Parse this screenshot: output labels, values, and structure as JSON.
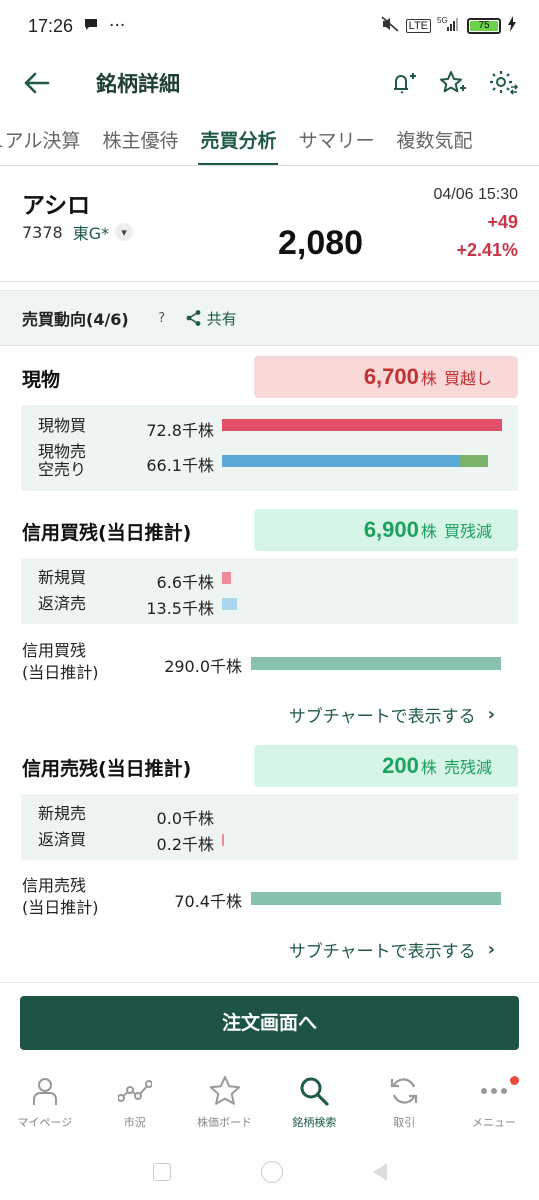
{
  "status_bar": {
    "time": "17:26",
    "battery": "75",
    "network": "5G"
  },
  "app_bar": {
    "title": "銘柄詳細"
  },
  "tabs": [
    {
      "label": "ュアル決算"
    },
    {
      "label": "株主優待"
    },
    {
      "label": "売買分析",
      "active": true
    },
    {
      "label": "サマリー"
    },
    {
      "label": "複数気配"
    }
  ],
  "stock": {
    "name": "アシロ",
    "code": "7378",
    "market": "東G*",
    "price": "2,080",
    "datetime": "04/06 15:30",
    "change": "+49",
    "change_pct": "+2.41%"
  },
  "trend": {
    "title": "売買動向(4/6)",
    "help": "?",
    "share": "共有"
  },
  "genbutsu": {
    "label": "現物",
    "summary_num": "6,700",
    "summary_unit": "株",
    "summary_text": "買越し",
    "rows": [
      {
        "label": "現物買",
        "value": "72.8千株"
      },
      {
        "label": "現物売",
        "label2": "空売り",
        "value": "66.1千株"
      }
    ],
    "buy_fraction": 1.0,
    "sell_fraction": 0.85,
    "short_fraction": 0.1
  },
  "margin_buy": {
    "label": "信用買残(当日推計)",
    "summary_num": "6,900",
    "summary_unit": "株",
    "summary_text": "買残減",
    "rows": [
      {
        "label": "新規買",
        "value": "6.6千株"
      },
      {
        "label": "返済売",
        "value": "13.5千株"
      }
    ],
    "balance_label": "信用買残",
    "balance_label2": "(当日推計)",
    "balance_value": "290.0千株",
    "subchart": "サブチャートで表示する"
  },
  "margin_sell": {
    "label": "信用売残(当日推計)",
    "summary_num": "200",
    "summary_unit": "株",
    "summary_text": "売残減",
    "rows": [
      {
        "label": "新規売",
        "value": "0.0千株"
      },
      {
        "label": "返済買",
        "value": "0.2千株"
      }
    ],
    "balance_label": "信用売残",
    "balance_label2": "(当日推計)",
    "balance_value": "70.4千株",
    "subchart": "サブチャートで表示する"
  },
  "order_button": "注文画面へ",
  "bottom_nav": [
    {
      "label": "マイページ",
      "icon": "person-icon"
    },
    {
      "label": "市況",
      "icon": "market-chart-icon"
    },
    {
      "label": "株価ボード",
      "icon": "star-icon"
    },
    {
      "label": "銘柄検索",
      "icon": "search-icon",
      "active": true
    },
    {
      "label": "取引",
      "icon": "refresh-icon"
    },
    {
      "label": "メニュー",
      "icon": "more-icon"
    }
  ],
  "colors": {
    "brand": "#1e5446",
    "up": "#c8364a",
    "buy_bar": "#e05068",
    "sell_bar": "#5aa9d6",
    "short_bar": "#7cb36a",
    "balance_bar": "#88c2ad"
  }
}
